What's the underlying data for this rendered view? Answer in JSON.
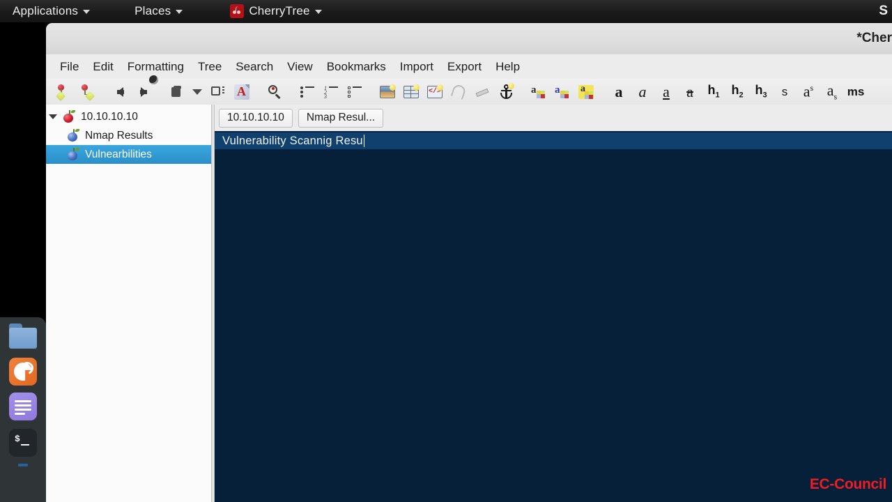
{
  "desktop": {
    "panel": {
      "items": [
        {
          "label": "Applications",
          "icon": "chevron-down-icon"
        },
        {
          "label": "Places",
          "icon": "chevron-down-icon"
        },
        {
          "label": "CherryTree",
          "icon": "cherrytree-icon"
        }
      ],
      "right_label": "S"
    },
    "dock": {
      "items": [
        {
          "name": "files-icon",
          "label": "Files"
        },
        {
          "name": "firefox-icon",
          "label": "Firefox"
        },
        {
          "name": "text-editor-icon",
          "label": "Text Editor"
        },
        {
          "name": "terminal-icon",
          "label": "Terminal",
          "prompt": "$"
        }
      ]
    }
  },
  "window": {
    "title": "*Cher",
    "menu": [
      "File",
      "Edit",
      "Formatting",
      "Tree",
      "Search",
      "View",
      "Bookmarks",
      "Import",
      "Export",
      "Help"
    ],
    "toolbar": [
      {
        "name": "add-node-icon",
        "label": "New Node"
      },
      {
        "name": "add-subnode-icon",
        "label": "New Sub Node"
      },
      {
        "name": "go-back-icon",
        "label": "Go Back"
      },
      {
        "name": "go-forward-icon",
        "label": "Go Forward"
      },
      {
        "name": "node-properties-icon",
        "label": "Node Properties"
      },
      {
        "name": "dropdown-arrow-icon",
        "label": "More"
      },
      {
        "name": "export-node-icon",
        "label": "Export Node"
      },
      {
        "name": "export-pdf-icon",
        "label": "Export to PDF"
      },
      {
        "name": "find-icon",
        "label": "Find"
      },
      {
        "name": "bulleted-list-icon",
        "label": "Bulleted List"
      },
      {
        "name": "numbered-list-icon",
        "label": "Numbered List"
      },
      {
        "name": "todo-list-icon",
        "label": "To-Do List"
      },
      {
        "name": "insert-image-icon",
        "label": "Insert Image"
      },
      {
        "name": "insert-table-icon",
        "label": "Insert Table"
      },
      {
        "name": "insert-codebox-icon",
        "label": "Insert CodeBox"
      },
      {
        "name": "attach-file-icon",
        "label": "Attach File"
      },
      {
        "name": "insert-link-icon",
        "label": "Insert Link"
      },
      {
        "name": "insert-anchor-icon",
        "label": "Insert Anchor"
      },
      {
        "name": "foreground-color-icon",
        "label": "Text Color Foreground"
      },
      {
        "name": "background-color-icon",
        "label": "Text Color Background"
      },
      {
        "name": "highlight-color-icon",
        "label": "Highlight"
      }
    ],
    "format_buttons": [
      {
        "name": "bold-button",
        "glyph": "a",
        "label": "Bold"
      },
      {
        "name": "italic-button",
        "glyph": "a",
        "label": "Italic"
      },
      {
        "name": "underline-button",
        "glyph": "a",
        "label": "Underline"
      },
      {
        "name": "strikethrough-button",
        "glyph": "a",
        "label": "Strikethrough"
      },
      {
        "name": "heading-1-button",
        "glyph": "h",
        "sub": "1",
        "label": "H1"
      },
      {
        "name": "heading-2-button",
        "glyph": "h",
        "sub": "2",
        "label": "H2"
      },
      {
        "name": "heading-3-button",
        "glyph": "h",
        "sub": "3",
        "label": "H3"
      },
      {
        "name": "small-text-button",
        "glyph": "s",
        "label": "Small"
      },
      {
        "name": "superscript-button",
        "glyph": "a",
        "sup": "s",
        "label": "Superscript"
      },
      {
        "name": "subscript-button",
        "glyph": "a",
        "sub": "s",
        "label": "Subscript"
      },
      {
        "name": "monospace-button",
        "glyph": "ms",
        "label": "Monospace"
      }
    ]
  },
  "tree": {
    "nodes": [
      {
        "label": "10.10.10.10",
        "icon": "red-cherry-icon",
        "level": 0,
        "expanded": true,
        "selected": false
      },
      {
        "label": "Nmap Results",
        "icon": "blue-cherry-icon",
        "level": 1,
        "selected": false
      },
      {
        "label": "Vulnearbilities",
        "icon": "blue-cherry-icon",
        "level": 1,
        "selected": true
      }
    ]
  },
  "editor": {
    "breadcrumbs": [
      {
        "label": "10.10.10.10"
      },
      {
        "label": "Nmap Resul..."
      }
    ],
    "content_line": "Vulnerability Scannig Resu",
    "watermark": "EC-Council",
    "colors": {
      "background": "#072039",
      "selection": "#10406e",
      "text": "#f2f2f2",
      "watermark": "#ee1c23",
      "tree_selection": "#2a8fc9"
    }
  }
}
